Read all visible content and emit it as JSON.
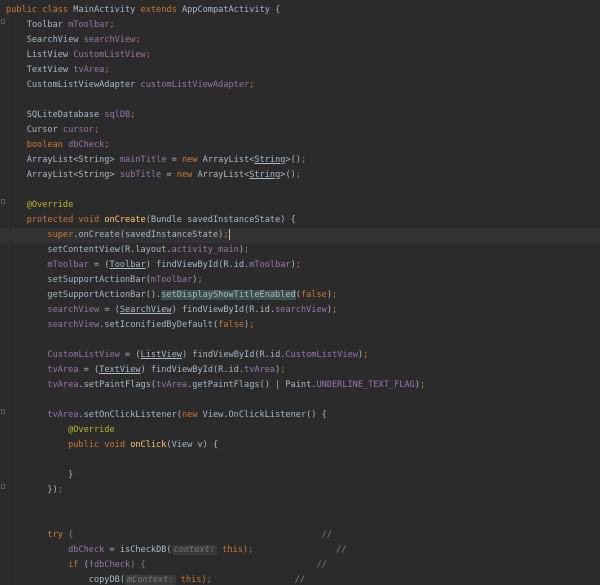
{
  "code_lines": [
    [
      {
        "t": "public class ",
        "c": "kw"
      },
      {
        "t": "MainActivity ",
        "c": "cls"
      },
      {
        "t": "extends ",
        "c": "kw"
      },
      {
        "t": "AppCompatActivity {",
        "c": "cls"
      }
    ],
    [
      {
        "t": "    Toolbar ",
        "c": "cls"
      },
      {
        "t": "mToolbar",
        "c": "fld"
      },
      {
        "t": ";",
        "c": "kw"
      }
    ],
    [
      {
        "t": "    SearchView ",
        "c": "cls"
      },
      {
        "t": "searchView",
        "c": "fld"
      },
      {
        "t": ";",
        "c": "kw"
      }
    ],
    [
      {
        "t": "    ListView ",
        "c": "cls"
      },
      {
        "t": "CustomListView",
        "c": "fld"
      },
      {
        "t": ";",
        "c": "kw"
      }
    ],
    [
      {
        "t": "    TextView ",
        "c": "cls"
      },
      {
        "t": "tvArea",
        "c": "fld"
      },
      {
        "t": ";",
        "c": "kw"
      }
    ],
    [
      {
        "t": "    CustomListViewAdapter ",
        "c": "cls"
      },
      {
        "t": "customListViewAdapter",
        "c": "fld"
      },
      {
        "t": ";",
        "c": "kw"
      }
    ],
    [],
    [
      {
        "t": "    SQLiteDatabase ",
        "c": "cls"
      },
      {
        "t": "sqlDB",
        "c": "fld"
      },
      {
        "t": ";",
        "c": "kw"
      }
    ],
    [
      {
        "t": "    Cursor ",
        "c": "cls"
      },
      {
        "t": "cursor",
        "c": "fld"
      },
      {
        "t": ";",
        "c": "kw"
      }
    ],
    [
      {
        "t": "    boolean ",
        "c": "kw"
      },
      {
        "t": "dbCheck",
        "c": "fld"
      },
      {
        "t": ";",
        "c": "kw"
      }
    ],
    [
      {
        "t": "    ArrayList<String> ",
        "c": "cls"
      },
      {
        "t": "mainTitle ",
        "c": "fld"
      },
      {
        "t": "= ",
        "c": "cls"
      },
      {
        "t": "new ",
        "c": "kw"
      },
      {
        "t": "ArrayList<",
        "c": "cls"
      },
      {
        "t": "String",
        "c": "cls ul"
      },
      {
        "t": ">()",
        "c": "cls"
      },
      {
        "t": ";",
        "c": "kw"
      }
    ],
    [
      {
        "t": "    ArrayList<String> ",
        "c": "cls"
      },
      {
        "t": "subTitle ",
        "c": "fld"
      },
      {
        "t": "= ",
        "c": "cls"
      },
      {
        "t": "new ",
        "c": "kw"
      },
      {
        "t": "ArrayList<",
        "c": "cls"
      },
      {
        "t": "String",
        "c": "cls ul"
      },
      {
        "t": ">()",
        "c": "cls"
      },
      {
        "t": ";",
        "c": "kw"
      }
    ],
    [],
    [
      {
        "t": "    @Override",
        "c": "ann"
      }
    ],
    [
      {
        "t": "    protected void ",
        "c": "kw"
      },
      {
        "t": "onCreate",
        "c": "fn"
      },
      {
        "t": "(Bundle savedInstanceState) {",
        "c": "cls"
      }
    ],
    [
      {
        "t": "        super",
        "c": "kw"
      },
      {
        "t": ".onCreate(savedInstanceState)",
        "c": "cls"
      },
      {
        "t": ";",
        "c": "kw"
      },
      {
        "caret": true
      }
    ],
    [
      {
        "t": "        setContentView(R.layout.",
        "c": "cls"
      },
      {
        "t": "activity_main",
        "c": "fld"
      },
      {
        "t": ")",
        "c": "cls"
      },
      {
        "t": ";",
        "c": "kw"
      }
    ],
    [
      {
        "t": "        ",
        "c": "cls"
      },
      {
        "t": "mToolbar ",
        "c": "fld"
      },
      {
        "t": "= (",
        "c": "cls"
      },
      {
        "t": "Toolbar",
        "c": "cls ul"
      },
      {
        "t": ") findViewById(R.id.",
        "c": "cls"
      },
      {
        "t": "mToolbar",
        "c": "fld"
      },
      {
        "t": ")",
        "c": "cls"
      },
      {
        "t": ";",
        "c": "kw"
      }
    ],
    [
      {
        "t": "        setSupportActionBar(",
        "c": "cls"
      },
      {
        "t": "mToolbar",
        "c": "fld"
      },
      {
        "t": ")",
        "c": "cls"
      },
      {
        "t": ";",
        "c": "kw"
      }
    ],
    [
      {
        "t": "        getSupportActionBar().",
        "c": "cls"
      },
      {
        "t": "setDisplayShowTitleEnabled",
        "c": "cls hl"
      },
      {
        "t": "(",
        "c": "cls"
      },
      {
        "t": "false",
        "c": "kw"
      },
      {
        "t": ")",
        "c": "cls"
      },
      {
        "t": ";",
        "c": "kw"
      }
    ],
    [
      {
        "t": "        ",
        "c": "cls"
      },
      {
        "t": "searchView ",
        "c": "fld"
      },
      {
        "t": "= (",
        "c": "cls"
      },
      {
        "t": "SearchView",
        "c": "cls ul"
      },
      {
        "t": ") findViewById(R.id.",
        "c": "cls"
      },
      {
        "t": "searchView",
        "c": "fld"
      },
      {
        "t": ")",
        "c": "cls"
      },
      {
        "t": ";",
        "c": "kw"
      }
    ],
    [
      {
        "t": "        ",
        "c": "cls"
      },
      {
        "t": "searchView",
        "c": "fld"
      },
      {
        "t": ".setIconifiedByDefault(",
        "c": "cls"
      },
      {
        "t": "false",
        "c": "kw"
      },
      {
        "t": ")",
        "c": "cls"
      },
      {
        "t": ";",
        "c": "kw"
      }
    ],
    [],
    [
      {
        "t": "        ",
        "c": "cls"
      },
      {
        "t": "CustomListView ",
        "c": "fld"
      },
      {
        "t": "= (",
        "c": "cls"
      },
      {
        "t": "ListView",
        "c": "cls ul"
      },
      {
        "t": ") findViewById(R.id.",
        "c": "cls"
      },
      {
        "t": "CustomListView",
        "c": "fld"
      },
      {
        "t": ")",
        "c": "cls"
      },
      {
        "t": ";",
        "c": "kw"
      }
    ],
    [
      {
        "t": "        ",
        "c": "cls"
      },
      {
        "t": "tvArea ",
        "c": "fld"
      },
      {
        "t": "= (",
        "c": "cls"
      },
      {
        "t": "TextView",
        "c": "cls ul"
      },
      {
        "t": ") findViewById(R.id.",
        "c": "cls"
      },
      {
        "t": "tvArea",
        "c": "fld"
      },
      {
        "t": ")",
        "c": "cls"
      },
      {
        "t": ";",
        "c": "kw"
      }
    ],
    [
      {
        "t": "        ",
        "c": "cls"
      },
      {
        "t": "tvArea",
        "c": "fld"
      },
      {
        "t": ".setPaintFlags(",
        "c": "cls"
      },
      {
        "t": "tvArea",
        "c": "fld"
      },
      {
        "t": ".getPaintFlags() | Paint.",
        "c": "cls"
      },
      {
        "t": "UNDERLINE_TEXT_FLAG",
        "c": "fld"
      },
      {
        "t": ")",
        "c": "cls"
      },
      {
        "t": ";",
        "c": "kw"
      }
    ],
    [],
    [
      {
        "t": "        ",
        "c": "cls"
      },
      {
        "t": "tvArea",
        "c": "fld"
      },
      {
        "t": ".setOnClickListener(",
        "c": "cls"
      },
      {
        "t": "new ",
        "c": "kw"
      },
      {
        "t": "View.OnClickListener() {",
        "c": "cls"
      }
    ],
    [
      {
        "t": "            @Override",
        "c": "ann"
      }
    ],
    [
      {
        "t": "            public void ",
        "c": "kw"
      },
      {
        "t": "onClick",
        "c": "fn"
      },
      {
        "t": "(View v) {",
        "c": "cls"
      }
    ],
    [],
    [
      {
        "t": "            }",
        "c": "cls"
      }
    ],
    [
      {
        "t": "        })",
        "c": "cls"
      },
      {
        "t": ";",
        "c": "kw"
      }
    ],
    [],
    [],
    [
      {
        "t": "        try ",
        "c": "kw"
      },
      {
        "t": "{                                                //",
        "c": "cm"
      }
    ],
    [
      {
        "t": "            ",
        "c": "cls"
      },
      {
        "t": "dbCheck ",
        "c": "fld"
      },
      {
        "t": "= isCheckDB(",
        "c": "cls"
      },
      {
        "hint": "context:",
        "val": " this"
      },
      {
        "t": ")",
        "c": "kw"
      },
      {
        "t": ";                //",
        "c": "cm"
      }
    ],
    [
      {
        "t": "            if ",
        "c": "kw"
      },
      {
        "t": "(!",
        "c": "cls"
      },
      {
        "t": "dbCheck",
        "c": "fld"
      },
      {
        "t": ") {                                 //",
        "c": "cm"
      }
    ],
    [
      {
        "t": "                copyDB(",
        "c": "cls"
      },
      {
        "hint": "mContext:",
        "val": " this"
      },
      {
        "t": ")",
        "c": "kw"
      },
      {
        "t": ";                //",
        "c": "cm"
      }
    ]
  ]
}
